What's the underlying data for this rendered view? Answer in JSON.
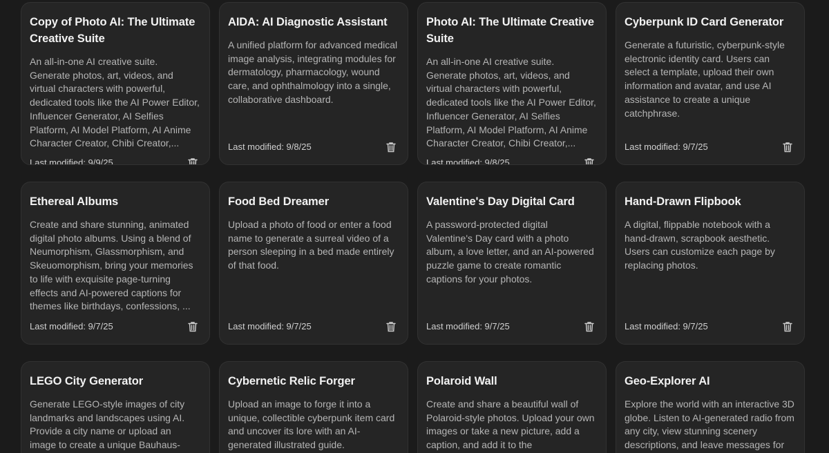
{
  "modified_prefix": "Last modified: ",
  "icons": {
    "delete": "trash-icon"
  },
  "cards": [
    {
      "title": "Copy of Photo AI: The Ultimate Creative Suite",
      "description": "An all-in-one AI creative suite. Generate photos, art, videos, and virtual characters with powerful, dedicated tools like the AI Power Editor, Influencer Generator, AI Selfies Platform, AI Model Platform, AI Anime Character Creator, Chibi Creator,...",
      "modified": "Last modified: 9/9/25"
    },
    {
      "title": "AIDA: AI Diagnostic Assistant",
      "description": "A unified platform for advanced medical image analysis, integrating modules for dermatology, pharmacology, wound care, and ophthalmology into a single, collaborative dashboard.",
      "modified": "Last modified: 9/8/25"
    },
    {
      "title": "Photo AI: The Ultimate Creative Suite",
      "description": "An all-in-one AI creative suite. Generate photos, art, videos, and virtual characters with powerful, dedicated tools like the AI Power Editor, Influencer Generator, AI Selfies Platform, AI Model Platform, AI Anime Character Creator, Chibi Creator,...",
      "modified": "Last modified: 9/8/25"
    },
    {
      "title": "Cyberpunk ID Card Generator",
      "description": "Generate a futuristic, cyberpunk-style electronic identity card. Users can select a template, upload their own information and avatar, and use AI assistance to create a unique catchphrase.",
      "modified": "Last modified: 9/7/25"
    },
    {
      "title": "Ethereal Albums",
      "description": "Create and share stunning, animated digital photo albums. Using a blend of Neumorphism, Glassmorphism, and Skeuomorphism, bring your memories to life with exquisite page-turning effects and AI-powered captions for themes like birthdays, confessions, ...",
      "modified": "Last modified: 9/7/25"
    },
    {
      "title": "Food Bed Dreamer",
      "description": "Upload a photo of food or enter a food name to generate a surreal video of a person sleeping in a bed made entirely of that food.",
      "modified": "Last modified: 9/7/25"
    },
    {
      "title": "Valentine's Day Digital Card",
      "description": "A password-protected digital Valentine's Day card with a photo album, a love letter, and an AI-powered puzzle game to create romantic captions for your photos.",
      "modified": "Last modified: 9/7/25"
    },
    {
      "title": "Hand-Drawn Flipbook",
      "description": "A digital, flippable notebook with a hand-drawn, scrapbook aesthetic. Users can customize each page by replacing photos.",
      "modified": "Last modified: 9/7/25"
    },
    {
      "title": "LEGO City Generator",
      "description": "Generate LEGO-style images of city landmarks and landscapes using AI. Provide a city name or upload an image to create a unique Bauhaus-",
      "modified": ""
    },
    {
      "title": "Cybernetic Relic Forger",
      "description": "Upload an image to forge it into a unique, collectible cyberpunk item card and uncover its lore with an AI-generated illustrated guide.",
      "modified": ""
    },
    {
      "title": "Polaroid Wall",
      "description": "Create and share a beautiful wall of Polaroid-style photos. Upload your own images or take a new picture, add a caption, and add it to the",
      "modified": ""
    },
    {
      "title": "Geo-Explorer AI",
      "description": "Explore the world with an interactive 3D globe. Listen to AI-generated radio from any city, view stunning scenery descriptions, and leave messages for",
      "modified": ""
    }
  ]
}
